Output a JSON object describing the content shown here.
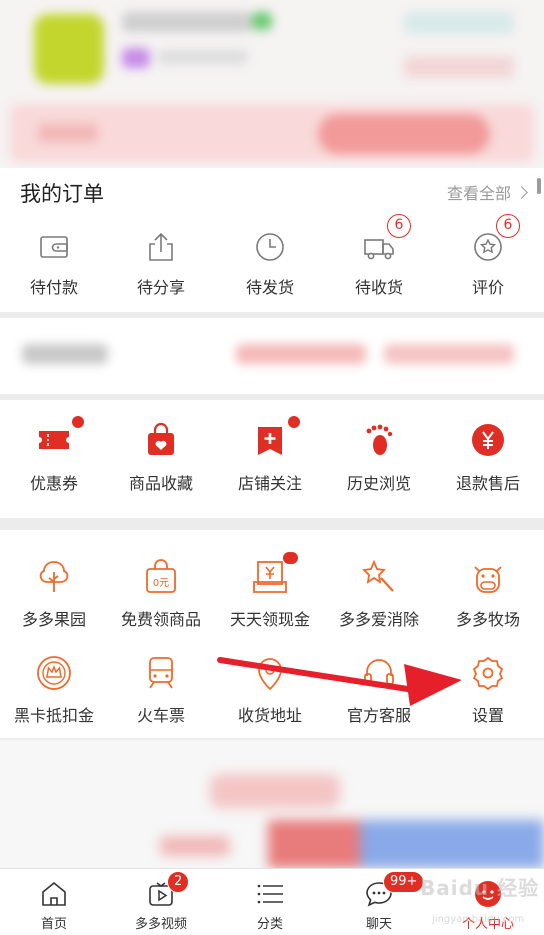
{
  "orders": {
    "title": "我的订单",
    "view_all": "查看全部",
    "items": [
      {
        "label": "待付款",
        "icon": "wallet-icon"
      },
      {
        "label": "待分享",
        "icon": "share-icon"
      },
      {
        "label": "待发货",
        "icon": "clock-icon"
      },
      {
        "label": "待收货",
        "icon": "truck-icon",
        "badge": "6"
      },
      {
        "label": "评价",
        "icon": "review-icon",
        "badge": "6"
      }
    ]
  },
  "services": {
    "items": [
      {
        "label": "优惠券",
        "icon": "coupon-icon"
      },
      {
        "label": "商品收藏",
        "icon": "favorite-bag-icon"
      },
      {
        "label": "店铺关注",
        "icon": "store-follow-icon"
      },
      {
        "label": "历史浏览",
        "icon": "footprint-icon"
      },
      {
        "label": "退款售后",
        "icon": "refund-icon"
      }
    ]
  },
  "tools": {
    "row1": [
      {
        "label": "多多果园",
        "icon": "tree-icon"
      },
      {
        "label": "免费领商品",
        "icon": "free-goods-icon"
      },
      {
        "label": "天天领现金",
        "icon": "cash-icon"
      },
      {
        "label": "多多爱消除",
        "icon": "star-wand-icon"
      },
      {
        "label": "多多牧场",
        "icon": "cow-icon"
      }
    ],
    "row2": [
      {
        "label": "黑卡抵扣金",
        "icon": "crown-badge-icon"
      },
      {
        "label": "火车票",
        "icon": "train-icon"
      },
      {
        "label": "收货地址",
        "icon": "location-icon"
      },
      {
        "label": "官方客服",
        "icon": "headset-icon"
      },
      {
        "label": "设置",
        "icon": "settings-gear-icon"
      }
    ]
  },
  "tabbar": {
    "items": [
      {
        "label": "首页",
        "icon": "home-icon"
      },
      {
        "label": "多多视频",
        "icon": "video-icon",
        "badge": "2"
      },
      {
        "label": "分类",
        "icon": "category-list-icon"
      },
      {
        "label": "聊天",
        "icon": "chat-icon",
        "badge": "99+"
      },
      {
        "label": "个人中心",
        "icon": "profile-icon"
      }
    ]
  },
  "watermark": {
    "text": "Baidu 经验",
    "url": "jingyan.baidu.com"
  },
  "colors": {
    "accent": "#e02e24",
    "orange": "#f06a2a",
    "text": "#333333",
    "muted": "#9a9a9a"
  }
}
